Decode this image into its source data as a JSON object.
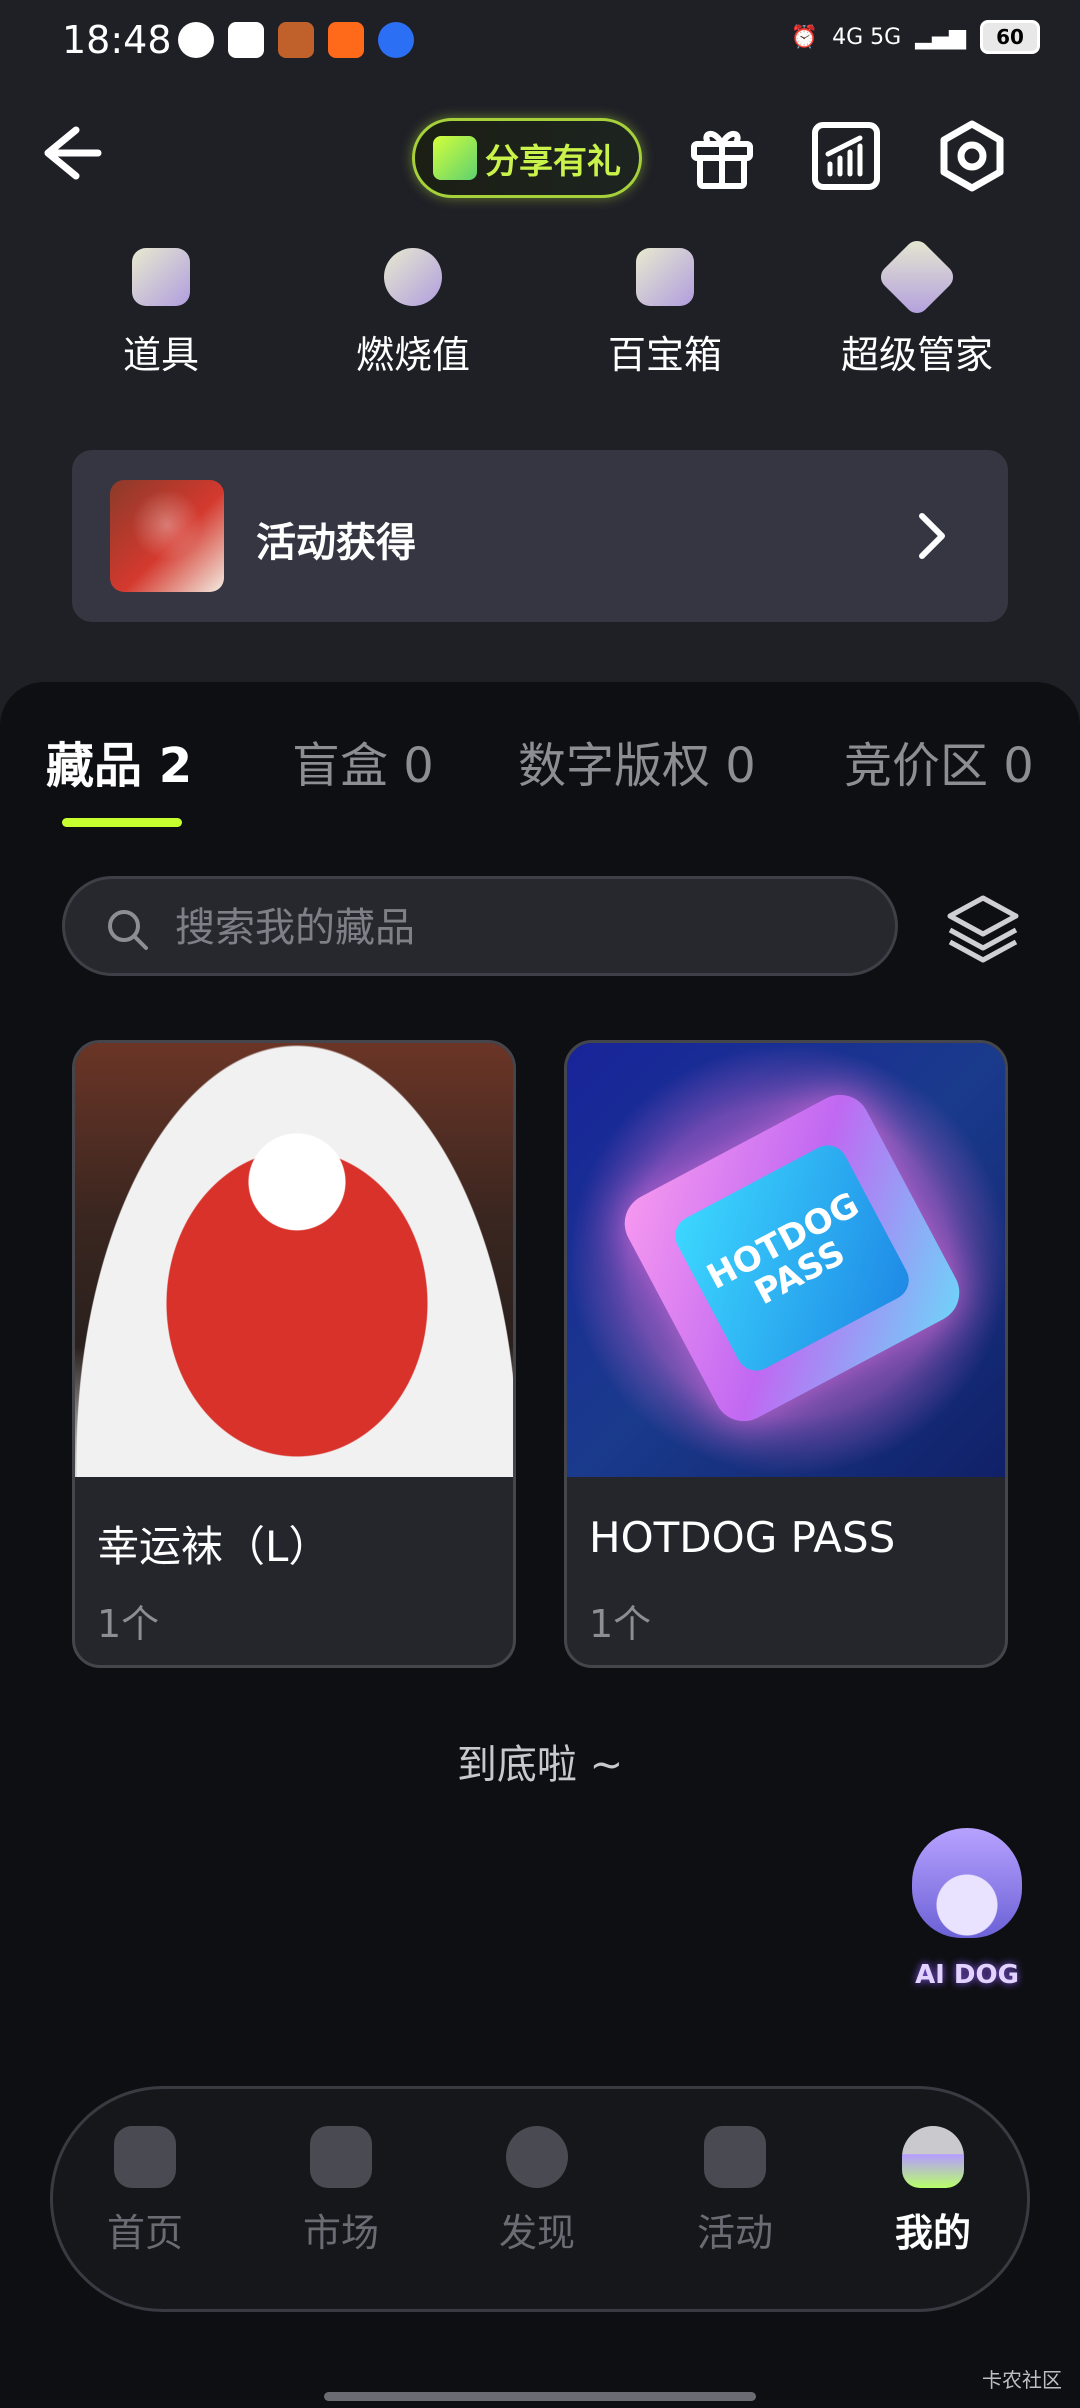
{
  "status_bar": {
    "time": "18:48",
    "right_text": "4G 5G",
    "battery": "60"
  },
  "header": {
    "share_button": "分享有礼"
  },
  "tools": [
    {
      "label": "道具",
      "icon": "star-box-icon"
    },
    {
      "label": "燃烧值",
      "icon": "flame-icon"
    },
    {
      "label": "百宝箱",
      "icon": "treasure-box-icon"
    },
    {
      "label": "超级管家",
      "icon": "v-badge-icon"
    }
  ],
  "activity": {
    "label": "活动获得"
  },
  "tabs": [
    {
      "label": "藏品 2",
      "active": true
    },
    {
      "label": "盲盒 0",
      "active": false
    },
    {
      "label": "数字版权 0",
      "active": false
    },
    {
      "label": "竞价区 0",
      "active": false
    }
  ],
  "search": {
    "placeholder": "搜索我的藏品"
  },
  "cards": [
    {
      "title": "幸运袜（L）",
      "count": "1个"
    },
    {
      "title": "HOTDOG PASS",
      "count": "1个",
      "ticket_text": "HOTDOG PASS"
    }
  ],
  "end_text": "到底啦 ~",
  "ai_dog": {
    "label": "AI DOG"
  },
  "bottom_nav": [
    {
      "label": "首页",
      "active": false
    },
    {
      "label": "市场",
      "active": false
    },
    {
      "label": "发现",
      "active": false
    },
    {
      "label": "活动",
      "active": false
    },
    {
      "label": "我的",
      "active": true
    }
  ],
  "watermark": "卡农社区",
  "colors": {
    "accent": "#c8ff2f",
    "background": "#1f2026",
    "panel": "#0e0f13"
  }
}
